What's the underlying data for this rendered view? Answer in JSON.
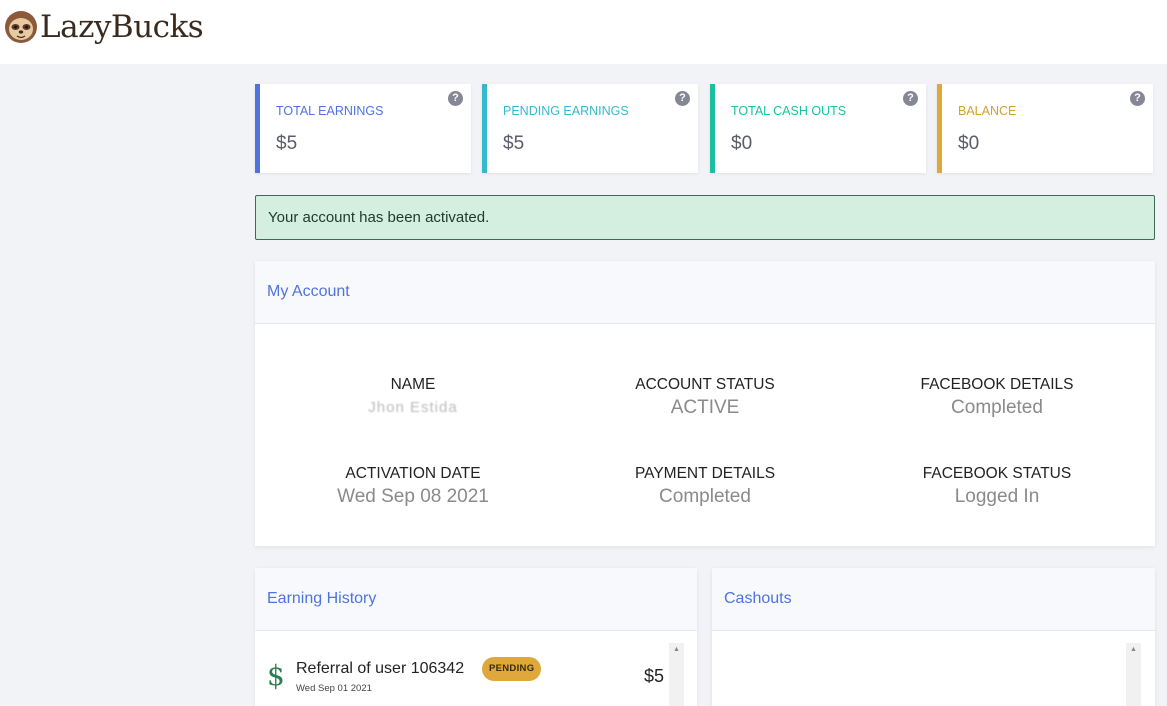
{
  "brand": {
    "name": "LazyBucks",
    "logo_icon": "sloth-icon"
  },
  "stats": [
    {
      "label": "TOTAL EARNINGS",
      "value": "$5",
      "color": "#4e73df",
      "help_icon": "help-icon"
    },
    {
      "label": "PENDING EARNINGS",
      "value": "$5",
      "color": "#36b9cc",
      "help_icon": "help-icon"
    },
    {
      "label": "TOTAL CASH OUTS",
      "value": "$0",
      "color": "#1cc0a0",
      "help_icon": "help-icon"
    },
    {
      "label": "BALANCE",
      "value": "$0",
      "color": "#e0a83a",
      "help_icon": "help-icon"
    }
  ],
  "alert": {
    "message": "Your account has been activated."
  },
  "account": {
    "title": "My Account",
    "fields": {
      "name": {
        "label": "NAME",
        "value": "Jhon Estida"
      },
      "account_status": {
        "label": "ACCOUNT STATUS",
        "value": "ACTIVE"
      },
      "facebook_details": {
        "label": "FACEBOOK DETAILS",
        "value": "Completed"
      },
      "activation_date": {
        "label": "ACTIVATION DATE",
        "value": "Wed Sep 08 2021"
      },
      "payment_details": {
        "label": "PAYMENT DETAILS",
        "value": "Completed"
      },
      "facebook_status": {
        "label": "FACEBOOK STATUS",
        "value": "Logged In"
      }
    }
  },
  "earning_history": {
    "title": "Earning History",
    "rows": [
      {
        "icon": "dollar-icon",
        "title": "Referral of user 106342",
        "date": "Wed Sep 01 2021",
        "badge": "PENDING",
        "amount": "$5"
      }
    ]
  },
  "cashouts": {
    "title": "Cashouts"
  }
}
